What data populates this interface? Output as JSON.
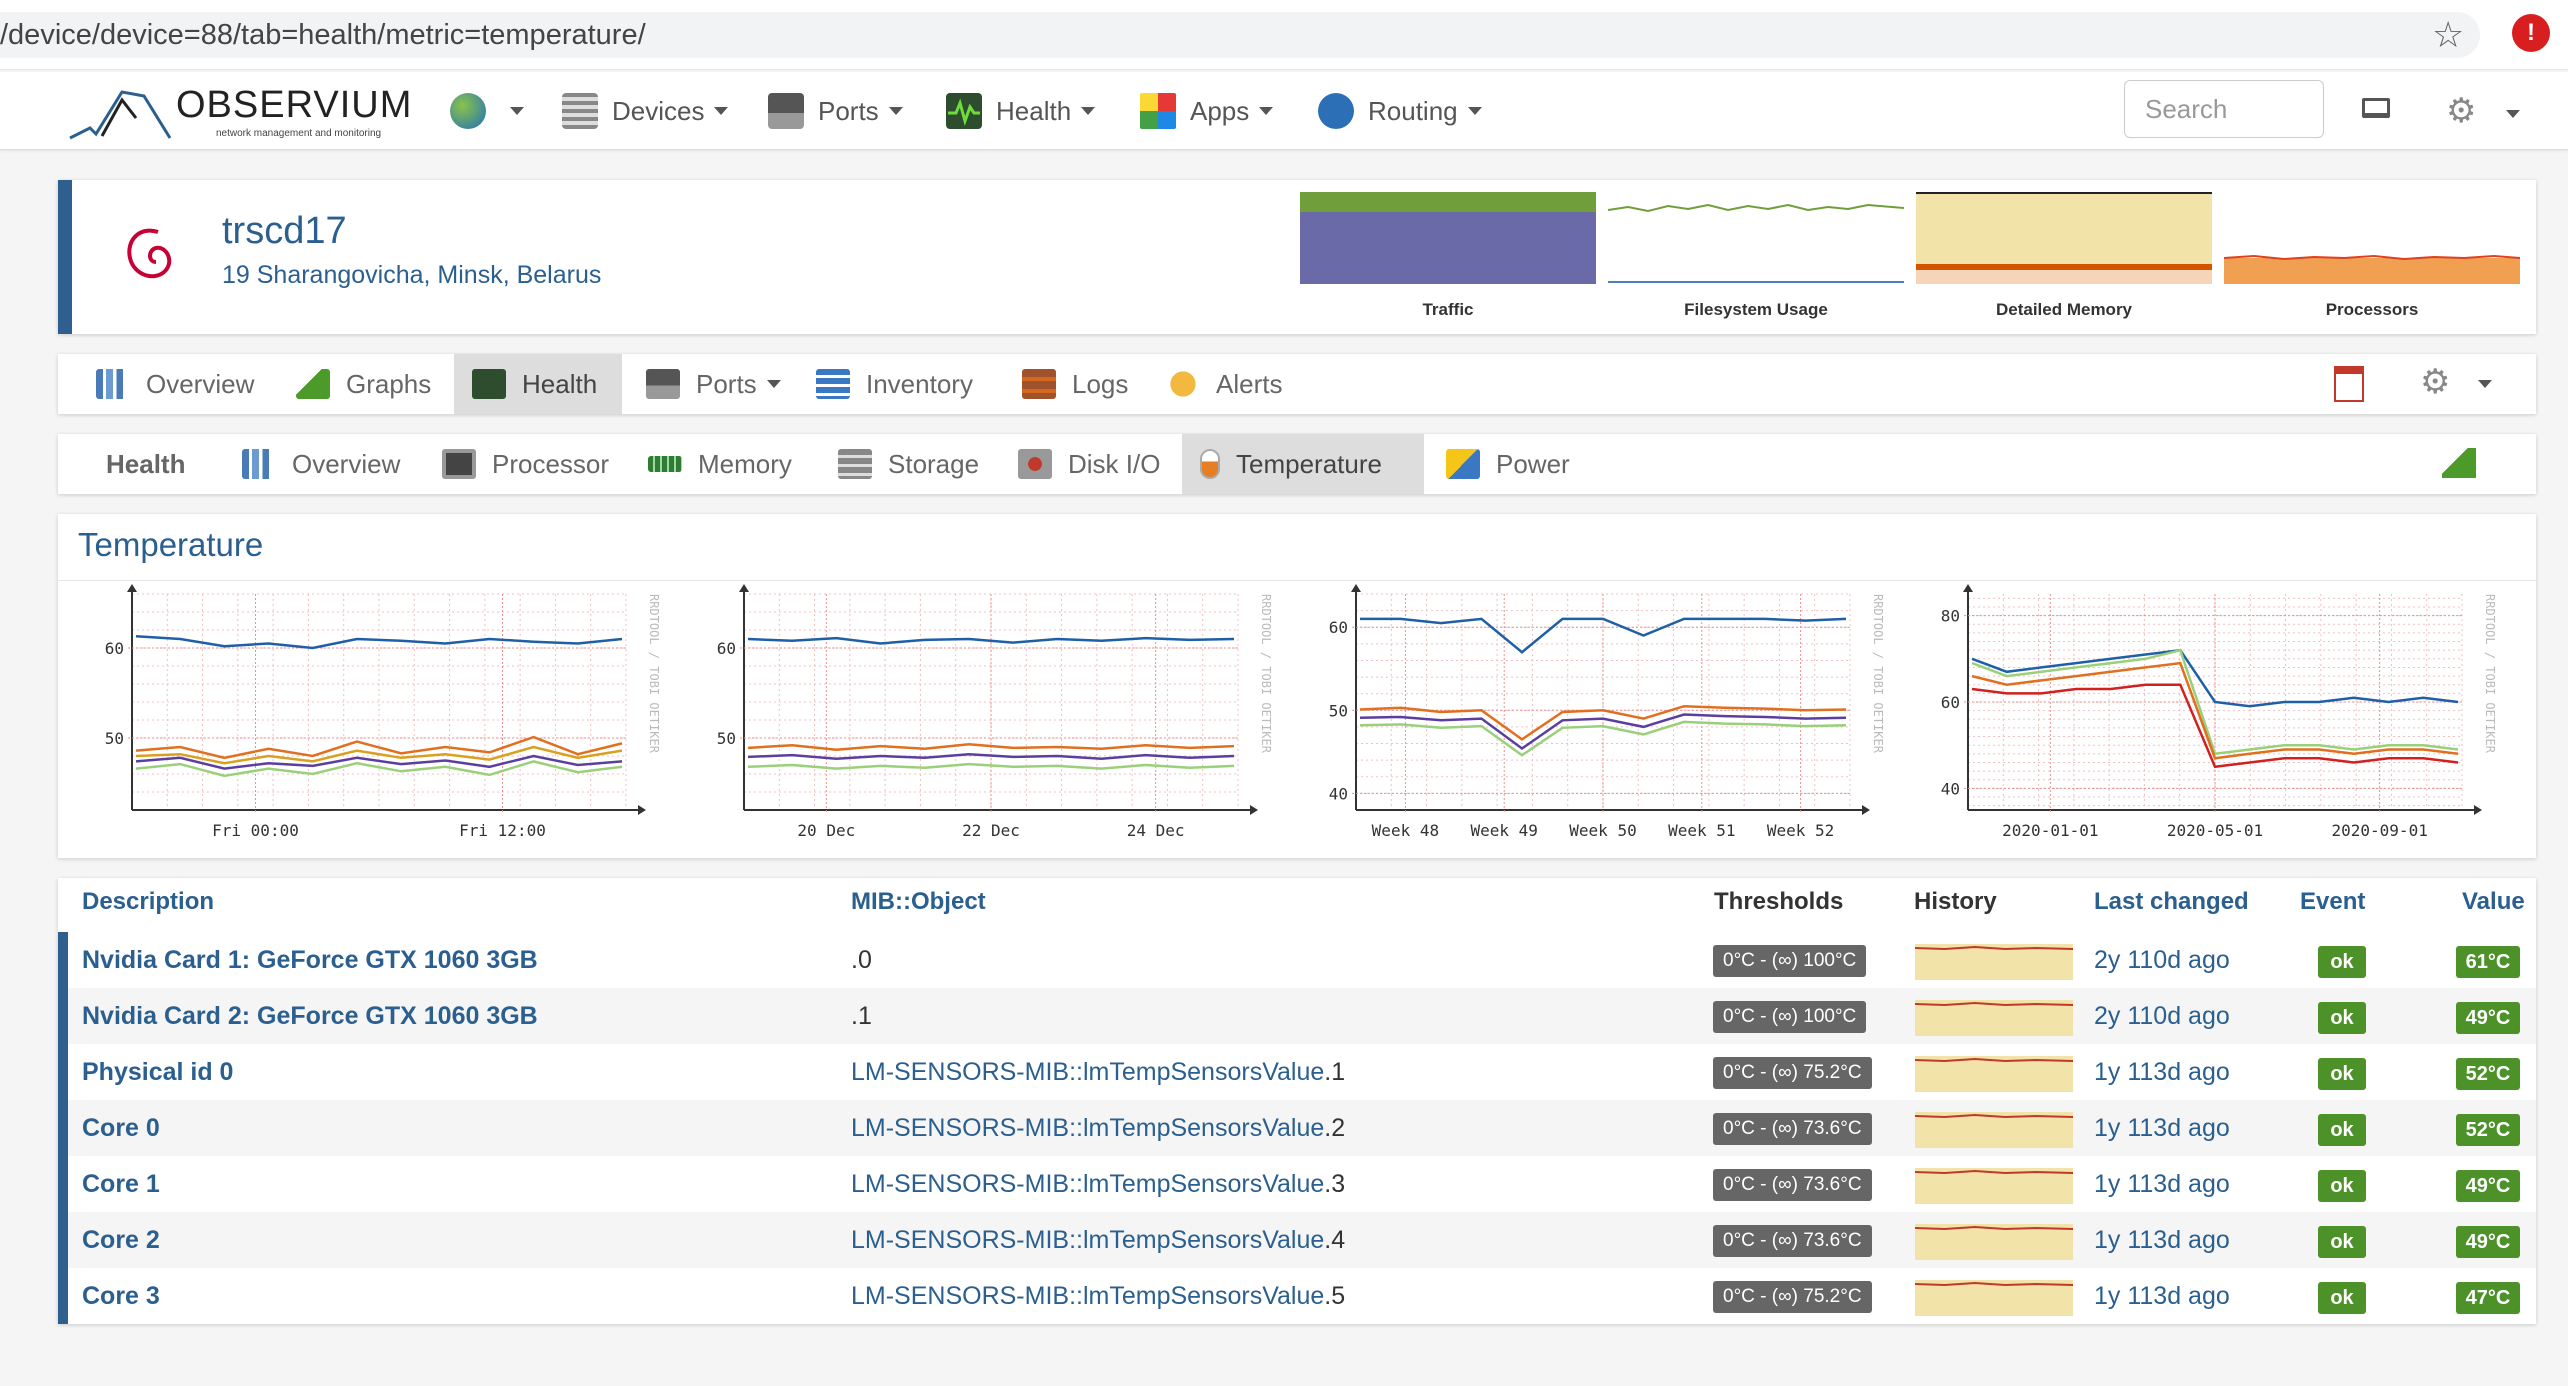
{
  "browser": {
    "url": "/device/device=88/tab=health/metric=temperature/"
  },
  "navbar": {
    "logo_text": "OBSERVIUM",
    "logo_sub": "network management and monitoring",
    "items": [
      {
        "label": ""
      },
      {
        "label": "Devices"
      },
      {
        "label": "Ports"
      },
      {
        "label": "Health"
      },
      {
        "label": "Apps"
      },
      {
        "label": "Routing"
      }
    ],
    "search_placeholder": "Search"
  },
  "device": {
    "hostname": "trscd17",
    "location": "19 Sharangovicha, Minsk, Belarus",
    "mini_graphs": [
      "Traffic",
      "Filesystem Usage",
      "Detailed Memory",
      "Processors"
    ]
  },
  "device_tabs": [
    "Overview",
    "Graphs",
    "Health",
    "Ports",
    "Inventory",
    "Logs",
    "Alerts"
  ],
  "health_tabs": {
    "title": "Health",
    "items": [
      "Overview",
      "Processor",
      "Memory",
      "Storage",
      "Disk I/O",
      "Temperature",
      "Power"
    ]
  },
  "temperature": {
    "title": "Temperature",
    "watermark": "RRDTOOL / TOBI OETIKER"
  },
  "chart_data": [
    {
      "type": "line",
      "x_ticks": [
        "Fri 00:00",
        "Fri 12:00"
      ],
      "y_ticks": [
        "50",
        "60"
      ],
      "ylim": [
        42,
        66
      ],
      "series": [
        {
          "color": "#1f5fa8",
          "values": [
            61.3,
            61.0,
            60.2,
            60.5,
            60.0,
            61.0,
            60.8,
            60.5,
            61.0,
            60.7,
            60.5,
            61.0
          ]
        },
        {
          "color": "#e07020",
          "values": [
            48.6,
            49.0,
            47.8,
            48.8,
            48.0,
            49.6,
            48.3,
            49.0,
            48.4,
            50.1,
            48.2,
            49.4
          ]
        },
        {
          "color": "#d9a020",
          "values": [
            48.0,
            48.2,
            47.2,
            48.0,
            47.4,
            48.6,
            47.8,
            48.2,
            47.6,
            49.0,
            47.8,
            48.6
          ]
        },
        {
          "color": "#5b3fa0",
          "values": [
            47.4,
            47.8,
            46.6,
            47.2,
            46.9,
            47.8,
            47.1,
            47.5,
            46.8,
            48.0,
            47.0,
            47.4
          ]
        },
        {
          "color": "#9ad07a",
          "values": [
            46.6,
            47.1,
            45.8,
            46.6,
            46.0,
            47.2,
            46.3,
            46.8,
            45.9,
            47.4,
            46.2,
            46.8
          ]
        }
      ]
    },
    {
      "type": "line",
      "x_ticks": [
        "20 Dec",
        "22 Dec",
        "24 Dec"
      ],
      "y_ticks": [
        "50",
        "60"
      ],
      "ylim": [
        42,
        66
      ],
      "series": [
        {
          "color": "#1f5fa8",
          "values": [
            61.0,
            60.8,
            61.1,
            60.5,
            60.9,
            61.0,
            60.6,
            61.0,
            60.8,
            61.1,
            60.9,
            61.0
          ]
        },
        {
          "color": "#e07020",
          "values": [
            48.9,
            49.2,
            48.7,
            49.1,
            48.8,
            49.3,
            48.9,
            49.0,
            48.8,
            49.2,
            48.9,
            49.1
          ]
        },
        {
          "color": "#5b3fa0",
          "values": [
            47.9,
            48.1,
            47.7,
            48.0,
            47.8,
            48.2,
            47.9,
            48.0,
            47.7,
            48.1,
            47.8,
            48.0
          ]
        },
        {
          "color": "#9ad07a",
          "values": [
            46.8,
            47.0,
            46.6,
            46.9,
            46.7,
            47.1,
            46.8,
            46.9,
            46.6,
            47.0,
            46.7,
            46.9
          ]
        }
      ]
    },
    {
      "type": "line",
      "x_ticks": [
        "Week 48",
        "Week 49",
        "Week 50",
        "Week 51",
        "Week 52"
      ],
      "y_ticks": [
        "40",
        "50",
        "60"
      ],
      "ylim": [
        38,
        64
      ],
      "series": [
        {
          "color": "#1f5fa8",
          "values": [
            61.0,
            61.0,
            60.5,
            61.0,
            57.0,
            61.0,
            61.0,
            59.0,
            61.0,
            61.0,
            61.0,
            60.8,
            61.0
          ]
        },
        {
          "color": "#e07020",
          "values": [
            50.1,
            50.3,
            49.8,
            50.0,
            46.5,
            49.8,
            50.0,
            49.0,
            50.5,
            50.3,
            50.2,
            50.0,
            50.1
          ]
        },
        {
          "color": "#5b3fa0",
          "values": [
            49.1,
            49.2,
            48.8,
            49.0,
            45.4,
            48.8,
            49.0,
            48.0,
            49.5,
            49.3,
            49.2,
            49.0,
            49.1
          ]
        },
        {
          "color": "#9ad07a",
          "values": [
            48.2,
            48.3,
            47.9,
            48.1,
            44.6,
            47.9,
            48.1,
            47.1,
            48.6,
            48.4,
            48.3,
            48.1,
            48.2
          ]
        }
      ]
    },
    {
      "type": "line",
      "x_ticks": [
        "2020-01-01",
        "2020-05-01",
        "2020-09-01"
      ],
      "y_ticks": [
        "40",
        "60",
        "80"
      ],
      "ylim": [
        35,
        85
      ],
      "series": [
        {
          "color": "#1f5fa8",
          "values": [
            70,
            67,
            68,
            69,
            70,
            71,
            72,
            60,
            59,
            60,
            60,
            61,
            60,
            61,
            60
          ]
        },
        {
          "color": "#9ad07a",
          "values": [
            69,
            66,
            67,
            68,
            69,
            70,
            72,
            48,
            49,
            50,
            50,
            49,
            50,
            50,
            49
          ]
        },
        {
          "color": "#e07020",
          "values": [
            66,
            64,
            65,
            66,
            67,
            68,
            69,
            47,
            48,
            49,
            49,
            48,
            49,
            49,
            48
          ]
        },
        {
          "color": "#d02020",
          "values": [
            63,
            62,
            62,
            63,
            63,
            64,
            64,
            45,
            46,
            47,
            47,
            46,
            47,
            47,
            46
          ]
        }
      ]
    }
  ],
  "table": {
    "headers": {
      "description": "Description",
      "mib": "MIB::Object",
      "thresholds": "Thresholds",
      "history": "History",
      "last_changed": "Last changed",
      "event": "Event",
      "value": "Value"
    },
    "rows": [
      {
        "description": "Nvidia Card 1: GeForce GTX 1060 3GB",
        "mib": "",
        "object": ".0",
        "thresholds": "0°C - (∞) 100°C",
        "last_changed": "2y 110d ago",
        "event": "ok",
        "value": "61°C"
      },
      {
        "description": "Nvidia Card 2: GeForce GTX 1060 3GB",
        "mib": "",
        "object": ".1",
        "thresholds": "0°C - (∞) 100°C",
        "last_changed": "2y 110d ago",
        "event": "ok",
        "value": "49°C"
      },
      {
        "description": "Physical id 0",
        "mib": "LM-SENSORS-MIB::lmTempSensorsValue",
        "object": ".1",
        "thresholds": "0°C - (∞) 75.2°C",
        "last_changed": "1y 113d ago",
        "event": "ok",
        "value": "52°C"
      },
      {
        "description": "Core 0",
        "mib": "LM-SENSORS-MIB::lmTempSensorsValue",
        "object": ".2",
        "thresholds": "0°C - (∞) 73.6°C",
        "last_changed": "1y 113d ago",
        "event": "ok",
        "value": "52°C"
      },
      {
        "description": "Core 1",
        "mib": "LM-SENSORS-MIB::lmTempSensorsValue",
        "object": ".3",
        "thresholds": "0°C - (∞) 73.6°C",
        "last_changed": "1y 113d ago",
        "event": "ok",
        "value": "49°C"
      },
      {
        "description": "Core 2",
        "mib": "LM-SENSORS-MIB::lmTempSensorsValue",
        "object": ".4",
        "thresholds": "0°C - (∞) 73.6°C",
        "last_changed": "1y 113d ago",
        "event": "ok",
        "value": "49°C"
      },
      {
        "description": "Core 3",
        "mib": "LM-SENSORS-MIB::lmTempSensorsValue",
        "object": ".5",
        "thresholds": "0°C - (∞) 75.2°C",
        "last_changed": "1y 113d ago",
        "event": "ok",
        "value": "47°C"
      }
    ]
  }
}
